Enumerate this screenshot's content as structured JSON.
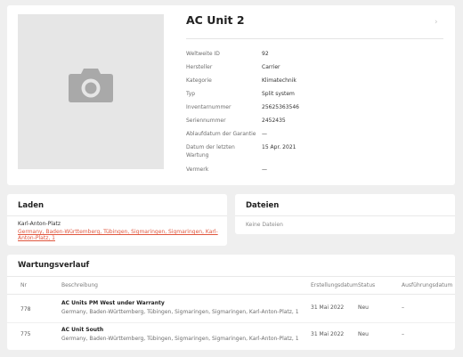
{
  "asset": {
    "title": "AC Unit 2",
    "more_icon": "chevron-right-icon",
    "photo_icon": "camera-icon",
    "details": [
      {
        "label": "Weltweite ID",
        "value": "92"
      },
      {
        "label": "Hersteller",
        "value": "Carrier"
      },
      {
        "label": "Kategorie",
        "value": "Klimatechnik"
      },
      {
        "label": "Typ",
        "value": "Split system"
      },
      {
        "label": "Inventarnummer",
        "value": "25625363546"
      },
      {
        "label": "Seriennummer",
        "value": "2452435"
      },
      {
        "label": "Ablaufdatum der Garantie",
        "value": "—"
      },
      {
        "label": "Datum der letzten Wartung",
        "value": "15 Apr. 2021"
      },
      {
        "label": "Vermerk",
        "value": "—"
      }
    ]
  },
  "store": {
    "heading": "Laden",
    "name": "Karl-Anton-Platz",
    "address": "Germany, Baden-Württemberg, Tübingen, Sigmaringen, Sigmaringen, Karl-Anton-Platz, 1"
  },
  "files": {
    "heading": "Dateien",
    "empty_text": "Keine Dateien"
  },
  "history": {
    "heading": "Wartungsverlauf",
    "columns": {
      "nr": "Nr",
      "description": "Beschreibung",
      "order_date": "Erstellungsdatum",
      "status": "Status",
      "execution_date": "Ausführungsdatum"
    },
    "rows": [
      {
        "nr": "778",
        "title": "AC Units PM West under Warranty",
        "location": "Germany, Baden-Württemberg, Tübingen, Sigmaringen, Sigmaringen, Karl-Anton-Platz, 1",
        "order_date": "31 Mai 2022",
        "status": "Neu",
        "execution_date": "–"
      },
      {
        "nr": "775",
        "title": "AC Unit South",
        "location": "Germany, Baden-Württemberg, Tübingen, Sigmaringen, Sigmaringen, Karl-Anton-Platz, 1",
        "order_date": "31 Mai 2022",
        "status": "Neu",
        "execution_date": "–"
      }
    ]
  }
}
